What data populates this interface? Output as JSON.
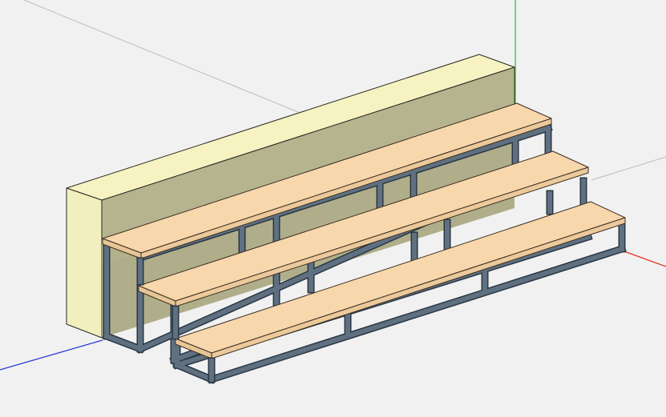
{
  "viewport": {
    "background": "#f1f1f1",
    "axes": {
      "x_color": "#e0301e",
      "y_color": "#22c22a",
      "z_color": "#2535d6",
      "guide_color": "#b9b9b9"
    }
  },
  "model": {
    "name": "",
    "parts": [
      {
        "kind": "back-wall",
        "color_front": "#f2efbf",
        "color_top": "#f6f2c2",
        "color_face": "#b5b38e"
      },
      {
        "kind": "tier-platform",
        "count": 3,
        "board_color": "#f8d7ac",
        "board_edge": "#e9c496"
      },
      {
        "kind": "steel-frame",
        "color": "#5d6e7e",
        "outline": "#2a3744"
      }
    ]
  }
}
